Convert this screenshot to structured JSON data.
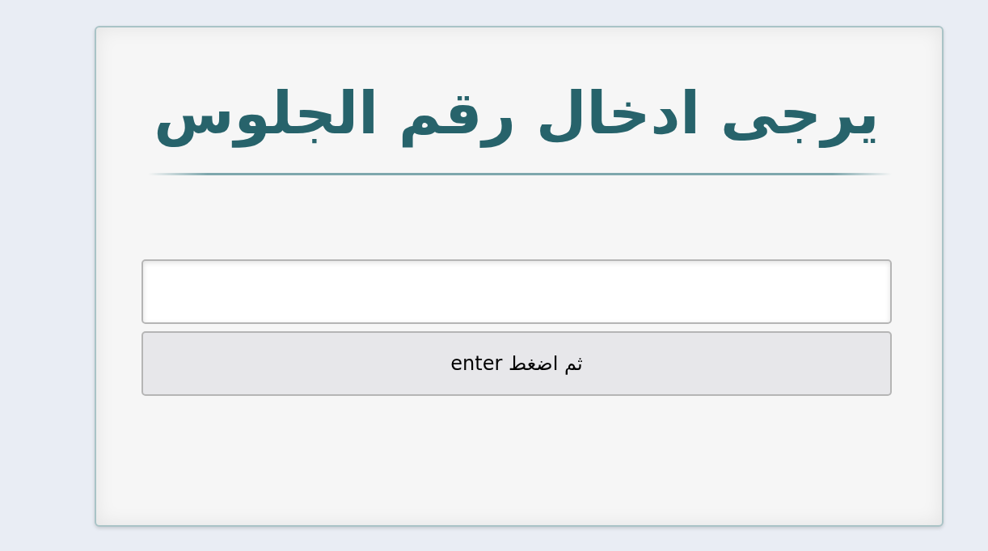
{
  "card": {
    "title": "يرجى ادخال رقم الجلوس"
  },
  "form": {
    "button": {
      "label": "ثم اضغط enter"
    }
  }
}
